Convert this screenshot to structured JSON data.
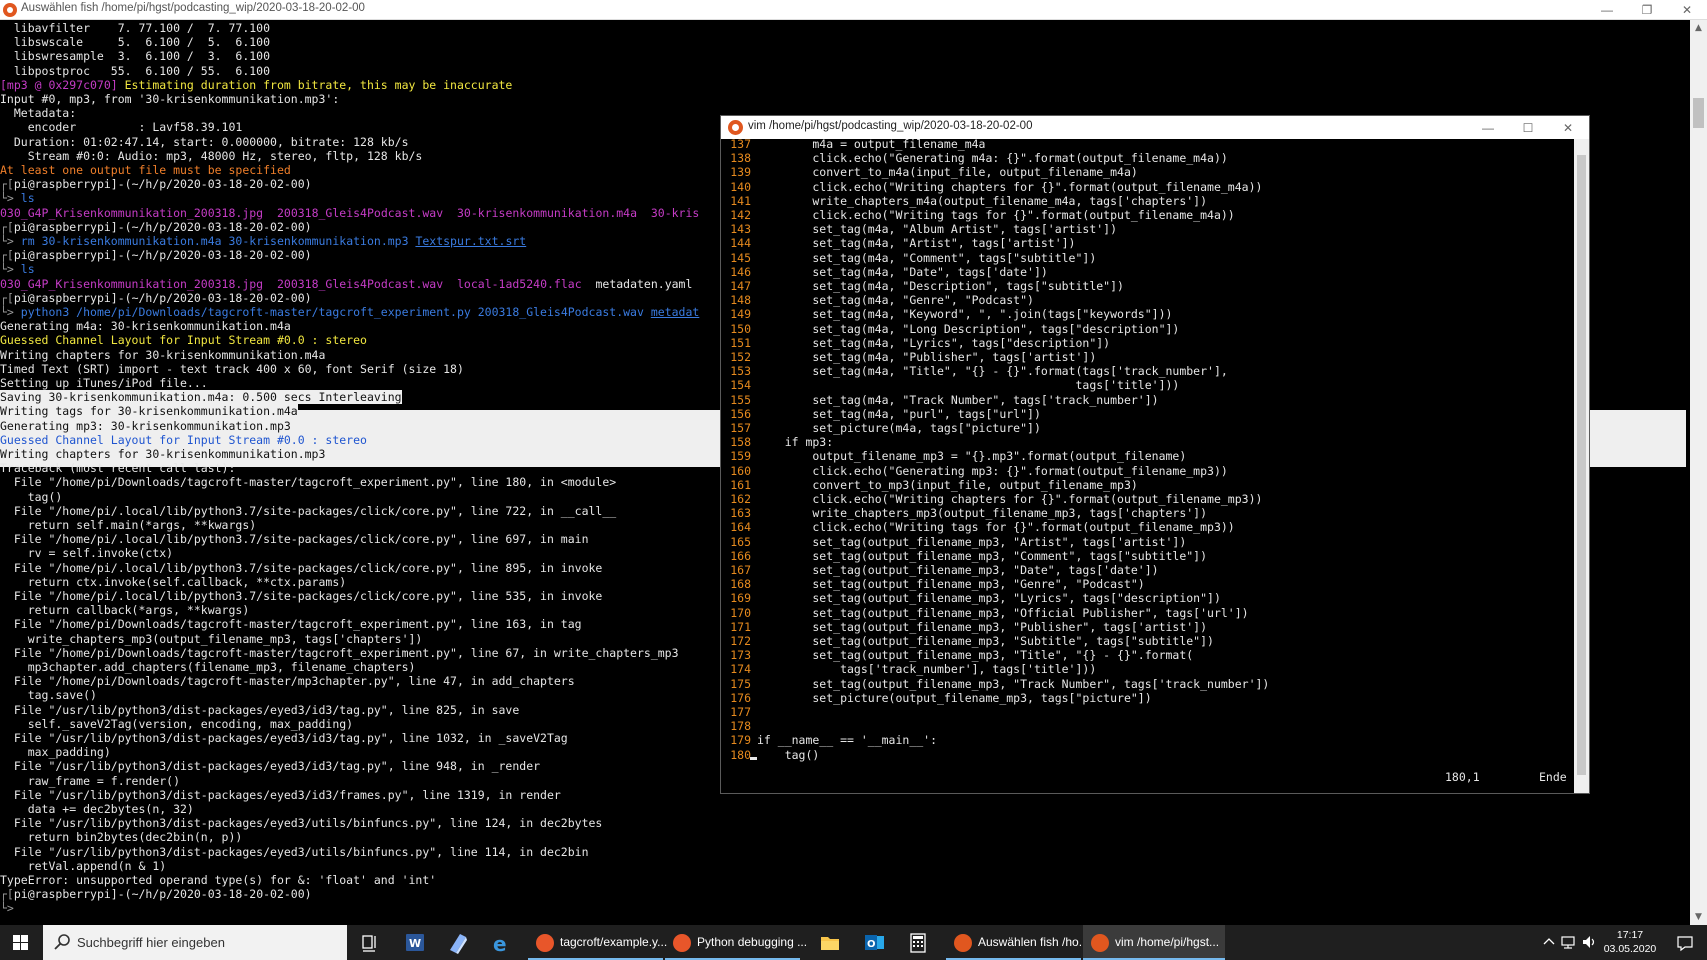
{
  "terminal": {
    "title": "Auswählen fish /home/pi/hgst/podcasting_wip/2020-03-18-20-02-00",
    "lines": [
      [
        {
          "t": "  libavfilter    7. 77.100 /  7. 77.100",
          "c": "w"
        }
      ],
      [
        {
          "t": "  libswscale     5.  6.100 /  5.  6.100",
          "c": "w"
        }
      ],
      [
        {
          "t": "  libswresample  3.  6.100 /  3.  6.100",
          "c": "w"
        }
      ],
      [
        {
          "t": "  libpostproc   55.  6.100 / 55.  6.100",
          "c": "w"
        }
      ],
      [
        {
          "t": "[mp3 @ 0x297c070] ",
          "c": "p"
        },
        {
          "t": "Estimating duration from bitrate, this may be inaccurate",
          "c": "y"
        }
      ],
      [
        {
          "t": "Input #0, mp3, from '30-krisenkommunikation.mp3':",
          "c": "w"
        }
      ],
      [
        {
          "t": "  Metadata:",
          "c": "w"
        }
      ],
      [
        {
          "t": "    encoder         : Lavf58.39.101",
          "c": "w"
        }
      ],
      [
        {
          "t": "  Duration: 01:02:47.14, start: 0.000000, bitrate: 128 kb/s",
          "c": "w"
        }
      ],
      [
        {
          "t": "    Stream #0:0: Audio: mp3, 48000 Hz, stereo, fltp, 128 kb/s",
          "c": "w"
        }
      ],
      [
        {
          "t": "At least one output file must be specified",
          "c": "o"
        }
      ],
      [
        {
          "t": "┌[",
          "c": "g"
        },
        {
          "t": "pi@raspberrypi",
          "c": "w"
        },
        {
          "t": "]-(~/h/p/2020-03-18-20-02-00)",
          "c": "w"
        }
      ],
      [
        {
          "t": "└> ",
          "c": "g"
        },
        {
          "t": "ls",
          "c": "b"
        }
      ],
      [
        {
          "t": "030_G4P_Krisenkommunikation_200318.jpg",
          "c": "p"
        },
        {
          "t": "  ",
          "c": "w"
        },
        {
          "t": "200318_Gleis4Podcast.wav",
          "c": "p"
        },
        {
          "t": "  ",
          "c": "w"
        },
        {
          "t": "30-krisenkommunikation.m4a",
          "c": "p"
        },
        {
          "t": "  30-kris",
          "c": "p"
        }
      ],
      [
        {
          "t": "┌[",
          "c": "g"
        },
        {
          "t": "pi@raspberrypi",
          "c": "w"
        },
        {
          "t": "]-(~/h/p/2020-03-18-20-02-00)",
          "c": "w"
        }
      ],
      [
        {
          "t": "└> ",
          "c": "g"
        },
        {
          "t": "rm ",
          "c": "b"
        },
        {
          "t": "30-krisenkommunikation.m4a 30-krisenkommunikation.mp3 ",
          "c": "b"
        },
        {
          "t": "Textspur.txt.srt",
          "c": "u"
        }
      ],
      [
        {
          "t": "┌[",
          "c": "g"
        },
        {
          "t": "pi@raspberrypi",
          "c": "w"
        },
        {
          "t": "]-(~/h/p/2020-03-18-20-02-00)",
          "c": "w"
        }
      ],
      [
        {
          "t": "└> ",
          "c": "g"
        },
        {
          "t": "ls",
          "c": "b"
        }
      ],
      [
        {
          "t": "030_G4P_Krisenkommunikation_200318.jpg",
          "c": "p"
        },
        {
          "t": "  ",
          "c": "w"
        },
        {
          "t": "200318_Gleis4Podcast.wav",
          "c": "p"
        },
        {
          "t": "  ",
          "c": "w"
        },
        {
          "t": "local-1ad5240.flac",
          "c": "p"
        },
        {
          "t": "  metadaten.yaml",
          "c": "w"
        }
      ],
      [
        {
          "t": "┌[",
          "c": "g"
        },
        {
          "t": "pi@raspberrypi",
          "c": "w"
        },
        {
          "t": "]-(~/h/p/2020-03-18-20-02-00)",
          "c": "w"
        }
      ],
      [
        {
          "t": "└> ",
          "c": "g"
        },
        {
          "t": "python3 ",
          "c": "b"
        },
        {
          "t": "/home/pi/Downloads/tagcroft-master/tagcroft_experiment.py 200318_Gleis4Podcast.wav ",
          "c": "b"
        },
        {
          "t": "metadat",
          "c": "u"
        }
      ],
      [
        {
          "t": "Generating m4a: 30-krisenkommunikation.m4a",
          "c": "w"
        }
      ],
      [
        {
          "t": "Guessed Channel Layout for Input Stream #0.0 : stereo",
          "c": "y"
        }
      ],
      [
        {
          "t": "Writing chapters for 30-krisenkommunikation.m4a",
          "c": "w"
        }
      ],
      [
        {
          "t": "Timed Text (SRT) import - text track 400 x 60, font Serif (size 18)",
          "c": "w"
        }
      ],
      [
        {
          "t": "Setting up iTunes/iPod file...",
          "c": "w"
        }
      ],
      [
        {
          "t": "Saving 30-krisenkommunikation.m4a: 0.500 secs Interleaving",
          "c": "s"
        }
      ],
      [
        {
          "t": "Writing tags for 30-krisenkommunikation.m4a",
          "c": "s"
        }
      ],
      [
        {
          "t": "Generating mp3: 30-krisenkommunikation.mp3",
          "c": "s"
        }
      ],
      [
        {
          "t": "Guessed Channel Layout for Input Stream #0.0 : stereo",
          "c": "sb"
        }
      ],
      [
        {
          "t": "Writing chapters for 30-krisenkommunikation.mp3",
          "c": "s"
        }
      ],
      [
        {
          "t": "Traceback (most recent call last):",
          "c": "w"
        }
      ],
      [
        {
          "t": "  File \"/home/pi/Downloads/tagcroft-master/tagcroft_experiment.py\", line 180, in <module>",
          "c": "w"
        }
      ],
      [
        {
          "t": "    tag()",
          "c": "w"
        }
      ],
      [
        {
          "t": "  File \"/home/pi/.local/lib/python3.7/site-packages/click/core.py\", line 722, in __call__",
          "c": "w"
        }
      ],
      [
        {
          "t": "    return self.main(*args, **kwargs)",
          "c": "w"
        }
      ],
      [
        {
          "t": "  File \"/home/pi/.local/lib/python3.7/site-packages/click/core.py\", line 697, in main",
          "c": "w"
        }
      ],
      [
        {
          "t": "    rv = self.invoke(ctx)",
          "c": "w"
        }
      ],
      [
        {
          "t": "  File \"/home/pi/.local/lib/python3.7/site-packages/click/core.py\", line 895, in invoke",
          "c": "w"
        }
      ],
      [
        {
          "t": "    return ctx.invoke(self.callback, **ctx.params)",
          "c": "w"
        }
      ],
      [
        {
          "t": "  File \"/home/pi/.local/lib/python3.7/site-packages/click/core.py\", line 535, in invoke",
          "c": "w"
        }
      ],
      [
        {
          "t": "    return callback(*args, **kwargs)",
          "c": "w"
        }
      ],
      [
        {
          "t": "  File \"/home/pi/Downloads/tagcroft-master/tagcroft_experiment.py\", line 163, in tag",
          "c": "w"
        }
      ],
      [
        {
          "t": "    write_chapters_mp3(output_filename_mp3, tags['chapters'])",
          "c": "w"
        }
      ],
      [
        {
          "t": "  File \"/home/pi/Downloads/tagcroft-master/tagcroft_experiment.py\", line 67, in write_chapters_mp3",
          "c": "w"
        }
      ],
      [
        {
          "t": "    mp3chapter.add_chapters(filename_mp3, filename_chapters)",
          "c": "w"
        }
      ],
      [
        {
          "t": "  File \"/home/pi/Downloads/tagcroft-master/mp3chapter.py\", line 47, in add_chapters",
          "c": "w"
        }
      ],
      [
        {
          "t": "    tag.save()",
          "c": "w"
        }
      ],
      [
        {
          "t": "  File \"/usr/lib/python3/dist-packages/eyed3/id3/tag.py\", line 825, in save",
          "c": "w"
        }
      ],
      [
        {
          "t": "    self._saveV2Tag(version, encoding, max_padding)",
          "c": "w"
        }
      ],
      [
        {
          "t": "  File \"/usr/lib/python3/dist-packages/eyed3/id3/tag.py\", line 1032, in _saveV2Tag",
          "c": "w"
        }
      ],
      [
        {
          "t": "    max_padding)",
          "c": "w"
        }
      ],
      [
        {
          "t": "  File \"/usr/lib/python3/dist-packages/eyed3/id3/tag.py\", line 948, in _render",
          "c": "w"
        }
      ],
      [
        {
          "t": "    raw_frame = f.render()",
          "c": "w"
        }
      ],
      [
        {
          "t": "  File \"/usr/lib/python3/dist-packages/eyed3/id3/frames.py\", line 1319, in render",
          "c": "w"
        }
      ],
      [
        {
          "t": "    data += dec2bytes(n, 32)",
          "c": "w"
        }
      ],
      [
        {
          "t": "  File \"/usr/lib/python3/dist-packages/eyed3/utils/binfuncs.py\", line 124, in dec2bytes",
          "c": "w"
        }
      ],
      [
        {
          "t": "    return bin2bytes(dec2bin(n, p))",
          "c": "w"
        }
      ],
      [
        {
          "t": "  File \"/usr/lib/python3/dist-packages/eyed3/utils/binfuncs.py\", line 114, in dec2bin",
          "c": "w"
        }
      ],
      [
        {
          "t": "    retVal.append(n & 1)",
          "c": "w"
        }
      ],
      [
        {
          "t": "TypeError: unsupported operand type(s) for &: 'float' and 'int'",
          "c": "w"
        }
      ],
      [
        {
          "t": "┌[",
          "c": "g"
        },
        {
          "t": "pi@raspberrypi",
          "c": "w"
        },
        {
          "t": "]-(~/h/p/2020-03-18-20-02-00)",
          "c": "w"
        }
      ],
      [
        {
          "t": "└> ",
          "c": "g"
        }
      ]
    ]
  },
  "vim": {
    "title": "vim /home/pi/hgst/podcasting_wip/2020-03-18-20-02-00",
    "lines": [
      {
        "n": "137",
        "code": "        m4a = output_filename_m4a"
      },
      {
        "n": "138",
        "code": "        click.echo(\"Generating m4a: {}\".format(output_filename_m4a))"
      },
      {
        "n": "139",
        "code": "        convert_to_m4a(input_file, output_filename_m4a)"
      },
      {
        "n": "140",
        "code": "        click.echo(\"Writing chapters for {}\".format(output_filename_m4a))"
      },
      {
        "n": "141",
        "code": "        write_chapters_m4a(output_filename_m4a, tags['chapters'])"
      },
      {
        "n": "142",
        "code": "        click.echo(\"Writing tags for {}\".format(output_filename_m4a))"
      },
      {
        "n": "143",
        "code": "        set_tag(m4a, \"Album Artist\", tags['artist'])"
      },
      {
        "n": "144",
        "code": "        set_tag(m4a, \"Artist\", tags['artist'])"
      },
      {
        "n": "145",
        "code": "        set_tag(m4a, \"Comment\", tags[\"subtitle\"])"
      },
      {
        "n": "146",
        "code": "        set_tag(m4a, \"Date\", tags['date'])"
      },
      {
        "n": "147",
        "code": "        set_tag(m4a, \"Description\", tags[\"subtitle\"])"
      },
      {
        "n": "148",
        "code": "        set_tag(m4a, \"Genre\", \"Podcast\")"
      },
      {
        "n": "149",
        "code": "        set_tag(m4a, \"Keyword\", \", \".join(tags[\"keywords\"]))"
      },
      {
        "n": "150",
        "code": "        set_tag(m4a, \"Long Description\", tags[\"description\"])"
      },
      {
        "n": "151",
        "code": "        set_tag(m4a, \"Lyrics\", tags[\"description\"])"
      },
      {
        "n": "152",
        "code": "        set_tag(m4a, \"Publisher\", tags['artist'])"
      },
      {
        "n": "153",
        "code": "        set_tag(m4a, \"Title\", \"{} - {}\".format(tags['track_number'],"
      },
      {
        "n": "154",
        "code": "                                              tags['title']))"
      },
      {
        "n": "155",
        "code": "        set_tag(m4a, \"Track Number\", tags['track_number'])"
      },
      {
        "n": "156",
        "code": "        set_tag(m4a, \"purl\", tags[\"url\"])"
      },
      {
        "n": "157",
        "code": "        set_picture(m4a, tags[\"picture\"])"
      },
      {
        "n": "158",
        "code": "    if mp3:"
      },
      {
        "n": "159",
        "code": "        output_filename_mp3 = \"{}.mp3\".format(output_filename)"
      },
      {
        "n": "160",
        "code": "        click.echo(\"Generating mp3: {}\".format(output_filename_mp3))"
      },
      {
        "n": "161",
        "code": "        convert_to_mp3(input_file, output_filename_mp3)"
      },
      {
        "n": "162",
        "code": "        click.echo(\"Writing chapters for {}\".format(output_filename_mp3))"
      },
      {
        "n": "163",
        "code": "        write_chapters_mp3(output_filename_mp3, tags['chapters'])"
      },
      {
        "n": "164",
        "code": "        click.echo(\"Writing tags for {}\".format(output_filename_mp3))"
      },
      {
        "n": "165",
        "code": "        set_tag(output_filename_mp3, \"Artist\", tags['artist'])"
      },
      {
        "n": "166",
        "code": "        set_tag(output_filename_mp3, \"Comment\", tags[\"subtitle\"])"
      },
      {
        "n": "167",
        "code": "        set_tag(output_filename_mp3, \"Date\", tags['date'])"
      },
      {
        "n": "168",
        "code": "        set_tag(output_filename_mp3, \"Genre\", \"Podcast\")"
      },
      {
        "n": "169",
        "code": "        set_tag(output_filename_mp3, \"Lyrics\", tags[\"description\"])"
      },
      {
        "n": "170",
        "code": "        set_tag(output_filename_mp3, \"Official Publisher\", tags['url'])"
      },
      {
        "n": "171",
        "code": "        set_tag(output_filename_mp3, \"Publisher\", tags['artist'])"
      },
      {
        "n": "172",
        "code": "        set_tag(output_filename_mp3, \"Subtitle\", tags[\"subtitle\"])"
      },
      {
        "n": "173",
        "code": "        set_tag(output_filename_mp3, \"Title\", \"{} - {}\".format("
      },
      {
        "n": "174",
        "code": "            tags['track_number'], tags['title']))"
      },
      {
        "n": "175",
        "code": "        set_tag(output_filename_mp3, \"Track Number\", tags['track_number'])"
      },
      {
        "n": "176",
        "code": "        set_picture(output_filename_mp3, tags[\"picture\"])"
      },
      {
        "n": "177",
        "code": ""
      },
      {
        "n": "178",
        "code": ""
      },
      {
        "n": "179",
        "code": "if __name__ == '__main__':"
      },
      {
        "n": "180",
        "code": "    tag()"
      }
    ],
    "status_position": "180,1",
    "status_end": "Ende"
  },
  "taskbar": {
    "search_placeholder": "Suchbegriff hier eingeben",
    "apps": [
      {
        "label": "tagcroft/example.y...",
        "color": "#e8562a"
      },
      {
        "label": "Python debugging ...",
        "color": "#e8562a"
      },
      {
        "label": "Auswählen fish /ho...",
        "color": "#e0571f"
      },
      {
        "label": "vim /home/pi/hgst...",
        "color": "#e0571f"
      }
    ],
    "time": "17:17",
    "date": "03.05.2020"
  },
  "colors": {
    "accent": "#76b9ed",
    "terminal_bg": "#000000",
    "vim_line_number": "#e68a1e"
  }
}
